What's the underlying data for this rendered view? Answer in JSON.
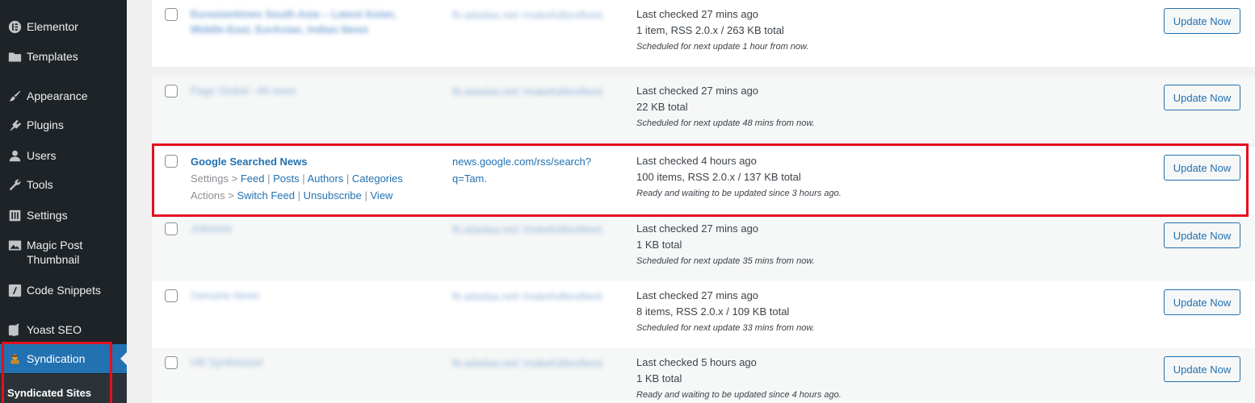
{
  "sidebar": {
    "items": [
      {
        "label": "Elementor",
        "icon": "elementor-icon"
      },
      {
        "label": "Templates",
        "icon": "folder-icon"
      },
      {
        "label": "Appearance",
        "icon": "paintbrush-icon"
      },
      {
        "label": "Plugins",
        "icon": "plugin-icon"
      },
      {
        "label": "Users",
        "icon": "user-icon"
      },
      {
        "label": "Tools",
        "icon": "wrench-icon"
      },
      {
        "label": "Settings",
        "icon": "settings-icon"
      },
      {
        "label": "Magic Post",
        "label2": "Thumbnail",
        "icon": "image-icon"
      },
      {
        "label": "Code Snippets",
        "icon": "code-icon"
      },
      {
        "label": "Yoast SEO",
        "icon": "yoast-icon"
      },
      {
        "label": "Syndication",
        "icon": "syndication-icon"
      }
    ],
    "submenu": {
      "label": "Syndicated Sites"
    }
  },
  "rows": [
    {
      "title": "Eurasiantimes South Asia – Latest Asian, Middle-East, EurAsian, Indian News",
      "url": "ftr.adadaa.net/ /makefulltextfeed.",
      "status1": "Last checked 27 mins ago",
      "status2": "1 item, RSS 2.0.x / 263 KB total",
      "status3": "Scheduled for next update 1 hour from now.",
      "button": "Update Now"
    },
    {
      "title": "Page Global - All news",
      "url": "ftr.adadaa.net/ /makefulltextfeed.",
      "status1": "Last checked 27 mins ago",
      "status2": "22 KB total",
      "status3": "Scheduled for next update 48 mins from now.",
      "button": "Update Now"
    },
    {
      "title": "Google Searched News",
      "url": "news.google.com/rss/search?q=Tam.",
      "settings_prefix": "Settings >",
      "settings_links": [
        "Feed",
        "Posts",
        "Authors",
        "Categories"
      ],
      "actions_prefix": "Actions >",
      "actions_links": [
        "Switch Feed",
        "Unsubscribe",
        "View"
      ],
      "status1": "Last checked 4 hours ago",
      "status2": "100 items, RSS 2.0.x / 137 KB total",
      "status3": "Ready and waiting to be updated since 3 hours ago.",
      "button": "Update Now"
    },
    {
      "title": "Jobnews",
      "url": "ftr.adadaa.net/ /makefulltextfeed.",
      "status1": "Last checked 27 mins ago",
      "status2": "1 KB total",
      "status3": "Scheduled for next update 35 mins from now.",
      "button": "Update Now"
    },
    {
      "title": "Genuine News",
      "url": "ftr.adadaa.net/ /makefulltextfeed.",
      "status1": "Last checked 27 mins ago",
      "status2": "8 items, RSS 2.0.x / 109 KB total",
      "status3": "Scheduled for next update 33 mins from now.",
      "button": "Update Now"
    },
    {
      "title": "HR Synthesizer",
      "url": "ftr.adadaa.net/ /makefulltextfeed.",
      "status1": "Last checked 5 hours ago",
      "status2": "1 KB total",
      "status3": "Ready and waiting to be updated since 4 hours ago.",
      "button": "Update Now"
    }
  ]
}
